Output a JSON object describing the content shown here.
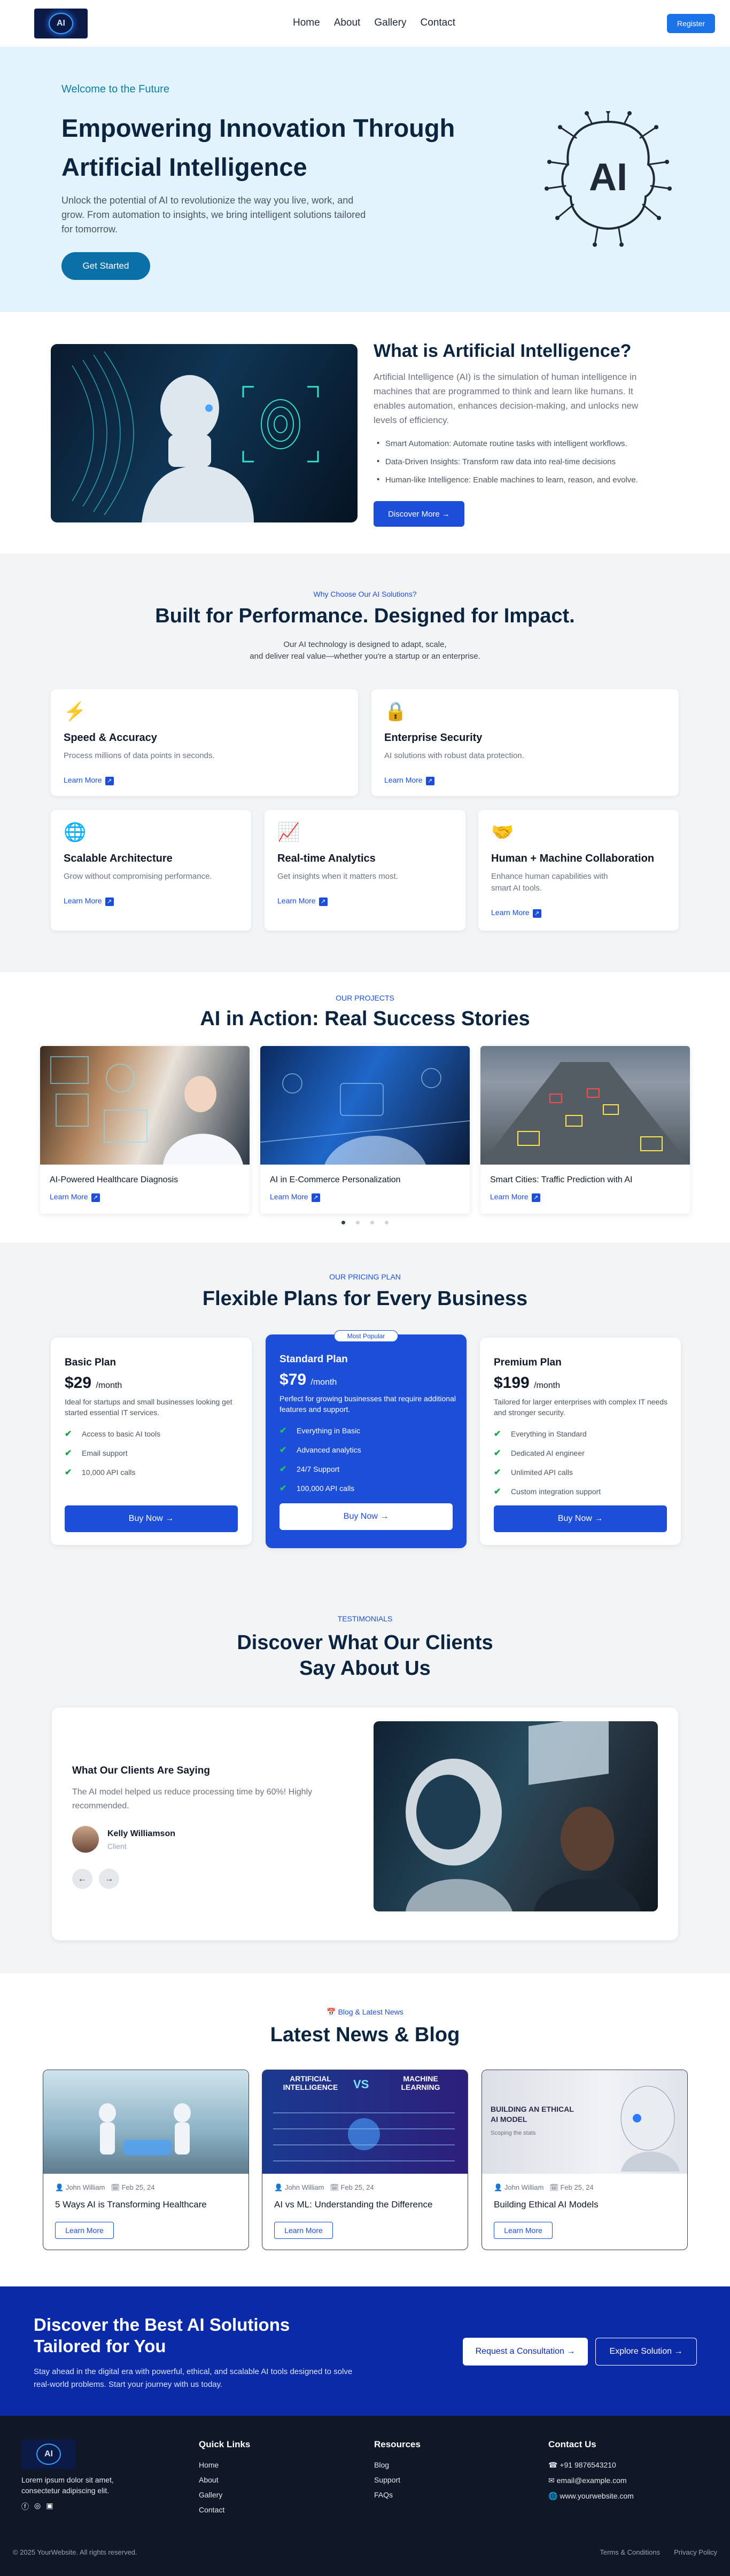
{
  "header": {
    "logo_text": "AI",
    "nav": [
      "Home",
      "About",
      "Gallery",
      "Contact"
    ],
    "register_label": "Register"
  },
  "hero": {
    "eyebrow": "Welcome to the Future",
    "title": "Empowering Innovation Through Artificial Intelligence",
    "text": "Unlock the potential of AI to revolutionize the way you live, work, and grow. From automation to insights, we bring intelligent solutions tailored for tomorrow.",
    "cta": "Get Started",
    "art_text": "AI"
  },
  "what": {
    "title": "What is Artificial Intelligence?",
    "text": "Artificial Intelligence (AI) is the simulation of human intelligence in machines that are programmed to think and learn like humans. It enables automation, enhances decision-making, and unlocks new levels of efficiency.",
    "bullets": [
      "Smart Automation: Automate routine tasks with intelligent workflows.",
      "Data-Driven Insights: Transform raw data into real-time decisions",
      "Human-like Intelligence: Enable machines to learn, reason, and evolve."
    ],
    "cta": "Discover More →"
  },
  "features": {
    "eyebrow": "Why Choose Our AI Solutions?",
    "title": "Built for Performance. Designed for Impact.",
    "subtitle_1": "Our AI technology is designed to adapt, scale,",
    "subtitle_2": "and deliver real value—whether you're a startup or an enterprise.",
    "learn_more": "Learn More",
    "cards": [
      {
        "icon": "lightning-icon",
        "glyph": "⚡",
        "title": "Speed & Accuracy",
        "text": "Process millions of data points in seconds."
      },
      {
        "icon": "lock-icon",
        "glyph": "🔒",
        "title": "Enterprise Security",
        "text": "AI solutions with robust data protection."
      },
      {
        "icon": "globe-icon",
        "glyph": "🌐",
        "title": "Scalable Architecture",
        "text": "Grow without compromising performance."
      },
      {
        "icon": "chart-icon",
        "glyph": "📈",
        "title": "Real-time Analytics",
        "text": "Get insights when it matters most."
      },
      {
        "icon": "handshake-icon",
        "glyph": "🤝",
        "title": "Human + Machine Collaboration",
        "text": "Enhance human capabilities with smart AI tools."
      }
    ]
  },
  "projects": {
    "eyebrow": "OUR PROJECTS",
    "title": "AI in Action: Real Success Stories",
    "learn_more": "Learn More",
    "items": [
      {
        "title": "AI-Powered Healthcare Diagnosis"
      },
      {
        "title": "AI in E-Commerce Personalization"
      },
      {
        "title": "Smart Cities: Traffic Prediction with AI"
      }
    ],
    "active_slide": 1
  },
  "pricing": {
    "eyebrow": "OUR PRICING PLAN",
    "title": "Flexible Plans for Every Business",
    "per": "/month",
    "popular_badge": "Most Popular",
    "plans": [
      {
        "name": "Basic Plan",
        "price": "$29",
        "desc": "Ideal for startups and small businesses looking get started essential IT services.",
        "features": [
          "Access to basic AI tools",
          "Email support",
          "10,000 API calls"
        ],
        "cta": "Buy Now →"
      },
      {
        "name": "Standard Plan",
        "price": "$79",
        "desc": "Perfect for growing businesses that require additional features and support.",
        "features": [
          "Everything in Basic",
          "Advanced analytics",
          "24/7 Support",
          "100,000 API calls"
        ],
        "cta": "Buy Now →"
      },
      {
        "name": "Premium Plan",
        "price": "$199",
        "desc": "Tailored for larger enterprises with complex IT needs and stronger security.",
        "features": [
          "Everything in Standard",
          "Dedicated AI engineer",
          "Unlimited API calls",
          "Custom integration support"
        ],
        "cta": "Buy Now →"
      }
    ]
  },
  "testimonials": {
    "eyebrow": "TESTIMONIALS",
    "title_1": "Discover What Our Clients",
    "title_2": "Say About Us",
    "card_title": "What Our Clients Are Saying",
    "quote": "The AI model helped us reduce processing time by 60%! Highly recommended.",
    "name": "Kelly Williamson",
    "role": "Client"
  },
  "blog": {
    "eyebrow": "Blog & Latest News",
    "title": "Latest News & Blog",
    "read_more": "Learn More",
    "posts": [
      {
        "author": "John William",
        "date": "Feb 25, 24",
        "title": "5 Ways AI is Transforming Healthcare"
      },
      {
        "author": "John William",
        "date": "Feb 25, 24",
        "title": "AI vs ML: Understanding the Difference",
        "img_left": "ARTIFICIAL INTELLIGENCE",
        "img_mid": "VS",
        "img_right": "MACHINE LEARNING"
      },
      {
        "author": "John William",
        "date": "Feb 25, 24",
        "title": "Building Ethical AI Models",
        "img_title": "BUILDING AN ETHICAL AI MODEL",
        "img_sub": "Scoping the stats"
      }
    ]
  },
  "cta": {
    "title": "Discover the Best AI Solutions Tailored for You",
    "text": "Stay ahead in the digital era with powerful, ethical, and scalable AI tools designed to solve real-world problems. Start your journey with us today.",
    "primary": "Request a Consultation →",
    "secondary": "Explore Solution →"
  },
  "footer": {
    "logo_text": "AI",
    "desc": "Lorem ipsum dolor sit amet, consectetur adipiscing elit.",
    "quick_title": "Quick Links",
    "quick": [
      "Home",
      "About",
      "Gallery",
      "Contact"
    ],
    "res_title": "Resources",
    "res": [
      "Blog",
      "Support",
      "FAQs"
    ],
    "contact_title": "Contact Us",
    "phone": "+91 9876543210",
    "email": "email@example.com",
    "web": "www.yourwebsite.com",
    "copyright": "© 2025 YourWebsite. All rights reserved.",
    "terms": "Terms & Conditions",
    "privacy": "Privacy Policy"
  },
  "colors": {
    "primary": "#1d4ed8",
    "hero_bg": "#e3f3fb",
    "cta_bg": "#0b2aa8",
    "footer_bg": "#101828"
  }
}
